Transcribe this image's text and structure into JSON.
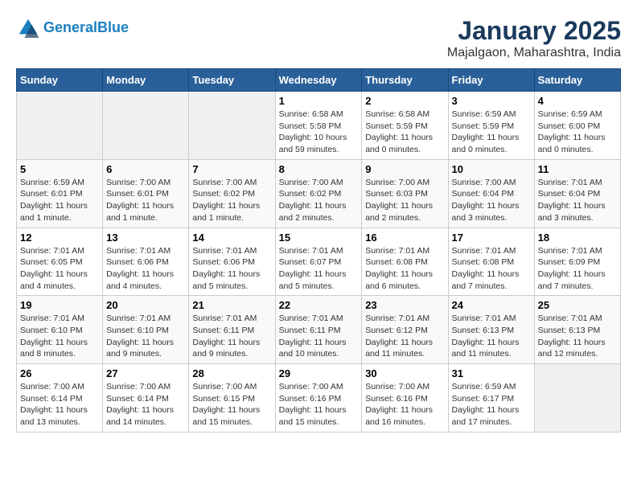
{
  "header": {
    "logo_line1": "General",
    "logo_line2": "Blue",
    "title": "January 2025",
    "subtitle": "Majalgaon, Maharashtra, India"
  },
  "weekdays": [
    "Sunday",
    "Monday",
    "Tuesday",
    "Wednesday",
    "Thursday",
    "Friday",
    "Saturday"
  ],
  "weeks": [
    [
      {
        "day": "",
        "info": ""
      },
      {
        "day": "",
        "info": ""
      },
      {
        "day": "",
        "info": ""
      },
      {
        "day": "1",
        "info": "Sunrise: 6:58 AM\nSunset: 5:58 PM\nDaylight: 10 hours and 59 minutes."
      },
      {
        "day": "2",
        "info": "Sunrise: 6:58 AM\nSunset: 5:59 PM\nDaylight: 11 hours and 0 minutes."
      },
      {
        "day": "3",
        "info": "Sunrise: 6:59 AM\nSunset: 5:59 PM\nDaylight: 11 hours and 0 minutes."
      },
      {
        "day": "4",
        "info": "Sunrise: 6:59 AM\nSunset: 6:00 PM\nDaylight: 11 hours and 0 minutes."
      }
    ],
    [
      {
        "day": "5",
        "info": "Sunrise: 6:59 AM\nSunset: 6:01 PM\nDaylight: 11 hours and 1 minute."
      },
      {
        "day": "6",
        "info": "Sunrise: 7:00 AM\nSunset: 6:01 PM\nDaylight: 11 hours and 1 minute."
      },
      {
        "day": "7",
        "info": "Sunrise: 7:00 AM\nSunset: 6:02 PM\nDaylight: 11 hours and 1 minute."
      },
      {
        "day": "8",
        "info": "Sunrise: 7:00 AM\nSunset: 6:02 PM\nDaylight: 11 hours and 2 minutes."
      },
      {
        "day": "9",
        "info": "Sunrise: 7:00 AM\nSunset: 6:03 PM\nDaylight: 11 hours and 2 minutes."
      },
      {
        "day": "10",
        "info": "Sunrise: 7:00 AM\nSunset: 6:04 PM\nDaylight: 11 hours and 3 minutes."
      },
      {
        "day": "11",
        "info": "Sunrise: 7:01 AM\nSunset: 6:04 PM\nDaylight: 11 hours and 3 minutes."
      }
    ],
    [
      {
        "day": "12",
        "info": "Sunrise: 7:01 AM\nSunset: 6:05 PM\nDaylight: 11 hours and 4 minutes."
      },
      {
        "day": "13",
        "info": "Sunrise: 7:01 AM\nSunset: 6:06 PM\nDaylight: 11 hours and 4 minutes."
      },
      {
        "day": "14",
        "info": "Sunrise: 7:01 AM\nSunset: 6:06 PM\nDaylight: 11 hours and 5 minutes."
      },
      {
        "day": "15",
        "info": "Sunrise: 7:01 AM\nSunset: 6:07 PM\nDaylight: 11 hours and 5 minutes."
      },
      {
        "day": "16",
        "info": "Sunrise: 7:01 AM\nSunset: 6:08 PM\nDaylight: 11 hours and 6 minutes."
      },
      {
        "day": "17",
        "info": "Sunrise: 7:01 AM\nSunset: 6:08 PM\nDaylight: 11 hours and 7 minutes."
      },
      {
        "day": "18",
        "info": "Sunrise: 7:01 AM\nSunset: 6:09 PM\nDaylight: 11 hours and 7 minutes."
      }
    ],
    [
      {
        "day": "19",
        "info": "Sunrise: 7:01 AM\nSunset: 6:10 PM\nDaylight: 11 hours and 8 minutes."
      },
      {
        "day": "20",
        "info": "Sunrise: 7:01 AM\nSunset: 6:10 PM\nDaylight: 11 hours and 9 minutes."
      },
      {
        "day": "21",
        "info": "Sunrise: 7:01 AM\nSunset: 6:11 PM\nDaylight: 11 hours and 9 minutes."
      },
      {
        "day": "22",
        "info": "Sunrise: 7:01 AM\nSunset: 6:11 PM\nDaylight: 11 hours and 10 minutes."
      },
      {
        "day": "23",
        "info": "Sunrise: 7:01 AM\nSunset: 6:12 PM\nDaylight: 11 hours and 11 minutes."
      },
      {
        "day": "24",
        "info": "Sunrise: 7:01 AM\nSunset: 6:13 PM\nDaylight: 11 hours and 11 minutes."
      },
      {
        "day": "25",
        "info": "Sunrise: 7:01 AM\nSunset: 6:13 PM\nDaylight: 11 hours and 12 minutes."
      }
    ],
    [
      {
        "day": "26",
        "info": "Sunrise: 7:00 AM\nSunset: 6:14 PM\nDaylight: 11 hours and 13 minutes."
      },
      {
        "day": "27",
        "info": "Sunrise: 7:00 AM\nSunset: 6:14 PM\nDaylight: 11 hours and 14 minutes."
      },
      {
        "day": "28",
        "info": "Sunrise: 7:00 AM\nSunset: 6:15 PM\nDaylight: 11 hours and 15 minutes."
      },
      {
        "day": "29",
        "info": "Sunrise: 7:00 AM\nSunset: 6:16 PM\nDaylight: 11 hours and 15 minutes."
      },
      {
        "day": "30",
        "info": "Sunrise: 7:00 AM\nSunset: 6:16 PM\nDaylight: 11 hours and 16 minutes."
      },
      {
        "day": "31",
        "info": "Sunrise: 6:59 AM\nSunset: 6:17 PM\nDaylight: 11 hours and 17 minutes."
      },
      {
        "day": "",
        "info": ""
      }
    ]
  ]
}
